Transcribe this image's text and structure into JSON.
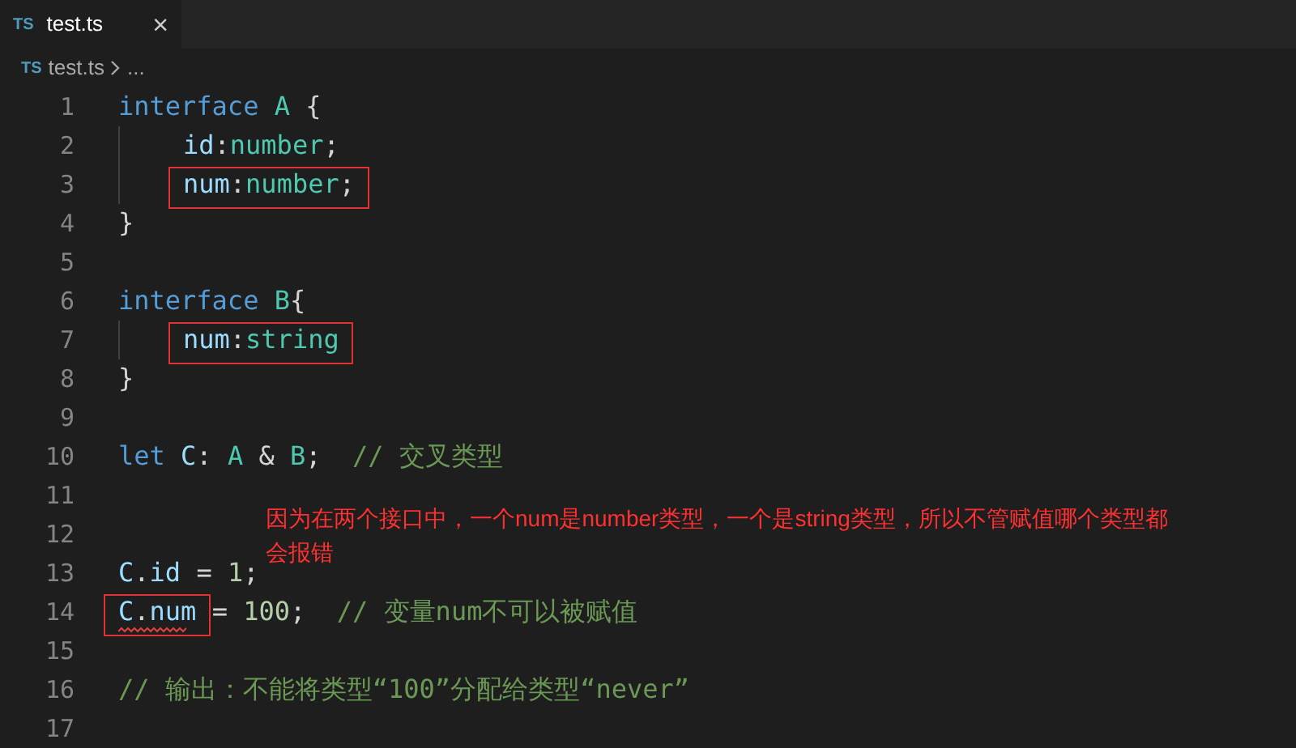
{
  "tab": {
    "icon": "TS",
    "label": "test.ts",
    "close": "×",
    "selected": true
  },
  "breadcrumb": {
    "icon": "TS",
    "file": "test.ts",
    "rest": "..."
  },
  "lines": [
    {
      "number": "1",
      "indented": false,
      "segments": [
        {
          "boxed": false,
          "error": false,
          "tokens": [
            {
              "kind": "keyword",
              "text": "interface "
            },
            {
              "kind": "type",
              "text": "A "
            },
            {
              "kind": "punct",
              "text": "{"
            }
          ]
        }
      ]
    },
    {
      "number": "2",
      "indented": true,
      "segments": [
        {
          "boxed": false,
          "error": false,
          "tokens": [
            {
              "kind": "prop",
              "text": "id"
            },
            {
              "kind": "punct",
              "text": ":"
            },
            {
              "kind": "type",
              "text": "number"
            },
            {
              "kind": "punct",
              "text": ";"
            }
          ]
        }
      ]
    },
    {
      "number": "3",
      "indented": true,
      "segments": [
        {
          "boxed": true,
          "error": false,
          "tokens": [
            {
              "kind": "prop",
              "text": "num"
            },
            {
              "kind": "punct",
              "text": ":"
            },
            {
              "kind": "type",
              "text": "number"
            },
            {
              "kind": "punct",
              "text": ";"
            }
          ]
        }
      ]
    },
    {
      "number": "4",
      "indented": false,
      "segments": [
        {
          "boxed": false,
          "error": false,
          "tokens": [
            {
              "kind": "punct",
              "text": "}"
            }
          ]
        }
      ]
    },
    {
      "number": "5",
      "indented": false
    },
    {
      "number": "6",
      "indented": false,
      "segments": [
        {
          "boxed": false,
          "error": false,
          "tokens": [
            {
              "kind": "keyword",
              "text": "interface "
            },
            {
              "kind": "type",
              "text": "B"
            },
            {
              "kind": "punct",
              "text": "{"
            }
          ]
        }
      ]
    },
    {
      "number": "7",
      "indented": true,
      "segments": [
        {
          "boxed": true,
          "error": false,
          "tokens": [
            {
              "kind": "prop",
              "text": "num"
            },
            {
              "kind": "punct",
              "text": ":"
            },
            {
              "kind": "type",
              "text": "string"
            }
          ]
        }
      ]
    },
    {
      "number": "8",
      "indented": false,
      "segments": [
        {
          "boxed": false,
          "error": false,
          "tokens": [
            {
              "kind": "punct",
              "text": "}"
            }
          ]
        }
      ]
    },
    {
      "number": "9",
      "indented": false
    },
    {
      "number": "10",
      "indented": false,
      "segments": [
        {
          "boxed": false,
          "error": false,
          "tokens": [
            {
              "kind": "keyword",
              "text": "let "
            },
            {
              "kind": "prop",
              "text": "C"
            },
            {
              "kind": "punct",
              "text": ": "
            },
            {
              "kind": "type",
              "text": "A "
            },
            {
              "kind": "punct",
              "text": "& "
            },
            {
              "kind": "type",
              "text": "B"
            },
            {
              "kind": "punct",
              "text": ";  "
            },
            {
              "kind": "comment",
              "text": "// 交叉类型"
            }
          ]
        }
      ]
    },
    {
      "number": "11",
      "indented": false
    },
    {
      "number": "12",
      "indented": false
    },
    {
      "number": "13",
      "indented": false,
      "segments": [
        {
          "boxed": false,
          "error": false,
          "tokens": [
            {
              "kind": "prop",
              "text": "C"
            },
            {
              "kind": "punct",
              "text": "."
            },
            {
              "kind": "prop",
              "text": "id "
            },
            {
              "kind": "punct",
              "text": "= "
            },
            {
              "kind": "number",
              "text": "1"
            },
            {
              "kind": "punct",
              "text": ";"
            }
          ]
        }
      ]
    },
    {
      "number": "14",
      "indented": false,
      "segments": [
        {
          "boxed": true,
          "error": true,
          "tokens": [
            {
              "kind": "prop",
              "text": "C"
            },
            {
              "kind": "punct",
              "text": "."
            },
            {
              "kind": "prop",
              "text": "num"
            }
          ]
        },
        {
          "boxed": false,
          "error": false,
          "tokens": [
            {
              "kind": "punct",
              "text": " = "
            },
            {
              "kind": "number",
              "text": "100"
            },
            {
              "kind": "punct",
              "text": ";  "
            },
            {
              "kind": "comment",
              "text": "// 变量num不可以被赋值"
            }
          ]
        }
      ]
    },
    {
      "number": "15",
      "indented": false
    },
    {
      "number": "16",
      "indented": false,
      "segments": [
        {
          "boxed": false,
          "error": false,
          "tokens": [
            {
              "kind": "comment",
              "text": "// 输出：不能将类型“100”分配给类型“never”"
            }
          ]
        }
      ]
    },
    {
      "number": "17",
      "indented": false
    }
  ],
  "annotation": "因为在两个接口中，一个num是number类型，一个是string类型，所以不管赋值哪个类型都会报错"
}
